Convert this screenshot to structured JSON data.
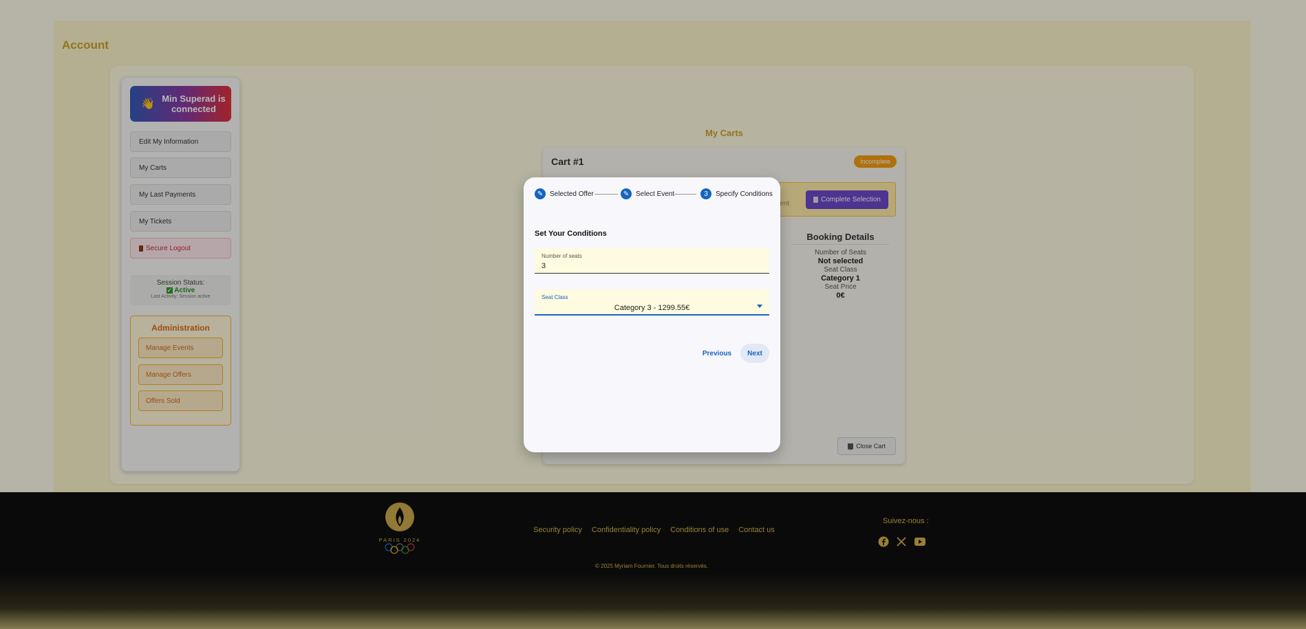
{
  "page": {
    "title": "Account"
  },
  "sidebar": {
    "user": {
      "wave_icon": "👋",
      "name": "Min Superad is connected"
    },
    "items": [
      {
        "label": "Edit My Information"
      },
      {
        "label": "My Carts"
      },
      {
        "label": "My Last Payments"
      },
      {
        "label": "My Tickets"
      },
      {
        "label": "Secure Logout"
      }
    ],
    "session": {
      "label": "Session Status:",
      "status": "Active",
      "activity": "Last Activity: Session active"
    },
    "admin": {
      "title": "Administration",
      "items": [
        {
          "label": "Manage Events"
        },
        {
          "label": "Manage Offers"
        },
        {
          "label": "Offers Sold"
        }
      ]
    }
  },
  "carts": {
    "title": "My Carts",
    "cart": {
      "title": "Cart #1",
      "badge": "Incomplete",
      "warning_fragment": "yment",
      "complete_button": "Complete Selection",
      "booking": {
        "title": "Booking Details",
        "rows": [
          {
            "label": "Number of Seats",
            "value": "Not selected"
          },
          {
            "label": "Seat Class",
            "value": "Category 1"
          },
          {
            "label": "Seat Price",
            "value": "0€"
          }
        ]
      },
      "close_button": "Close Cart"
    }
  },
  "modal": {
    "steps": [
      {
        "label": "Selected Offer"
      },
      {
        "label": "Select Event"
      },
      {
        "label": "Specify Conditions",
        "number": "3"
      }
    ],
    "section_title": "Set Your Conditions",
    "seats_field": {
      "label": "Number of seats",
      "value": "3"
    },
    "class_field": {
      "label": "Seat Class",
      "value": "Category 3 - 1299.55€"
    },
    "previous": "Previous",
    "next": "Next"
  },
  "footer": {
    "logo_text": "PARIS 2024",
    "links": [
      {
        "label": "Security policy"
      },
      {
        "label": "Confidentiality policy"
      },
      {
        "label": "Conditions of use"
      },
      {
        "label": "Contact us"
      }
    ],
    "follow": "Suivez-nous :",
    "socials": [
      {
        "icon": "facebook-icon"
      },
      {
        "icon": "x-icon"
      },
      {
        "icon": "youtube-icon"
      }
    ],
    "copyright": "© 2025 Myriam Fournier. Tous droits réservés."
  },
  "colors": {
    "accent": "#1565c0",
    "gold": "#c9a227",
    "admin": "#d96a1a",
    "badge": "#f39c12"
  }
}
